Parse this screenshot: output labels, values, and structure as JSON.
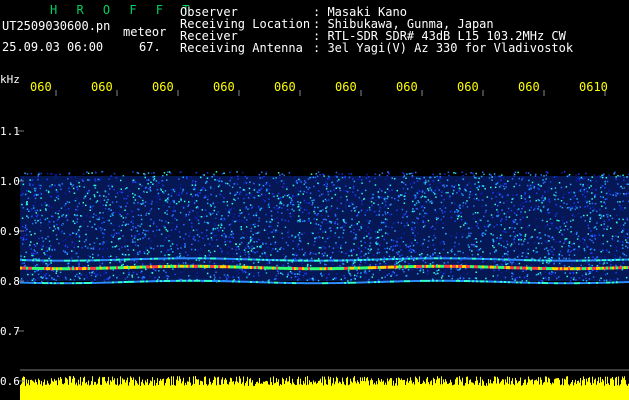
{
  "app": {
    "title": "H R O F F T",
    "mode": "meteor"
  },
  "file": {
    "name": "UT2509030600.pn",
    "datetime": "25.09.03 06:00",
    "value": "67."
  },
  "info": {
    "labels": [
      "Observer",
      "Receiving Location",
      "Receiver",
      "Receiving Antenna"
    ],
    "values": [
      ": Masaki Kano",
      ": Shibukawa, Gunma, Japan",
      ": RTL-SDR SDR# 43dB L15 103.2MHz CW",
      ": 3el Yagi(V) Az 330 for Vladivostok"
    ]
  },
  "colors": {
    "accent_title": "#00d060",
    "tick_labels": "#ffff00",
    "text": "#ffffff",
    "signal_base": "#0a2a9a"
  },
  "chart_data": {
    "type": "heatmap",
    "ylabel": "kHz",
    "yticks": [
      "1.1",
      "1.0",
      "0.9",
      "0.8",
      "0.7",
      "0.6"
    ],
    "ylim": [
      0.6,
      1.15
    ],
    "xticks": [
      "060",
      "060",
      "060",
      "060",
      "060",
      "060",
      "060",
      "060",
      "060",
      "0610"
    ],
    "signal_band": [
      0.8,
      1.02
    ],
    "strong_lines": [
      0.845,
      0.83,
      0.8
    ]
  }
}
